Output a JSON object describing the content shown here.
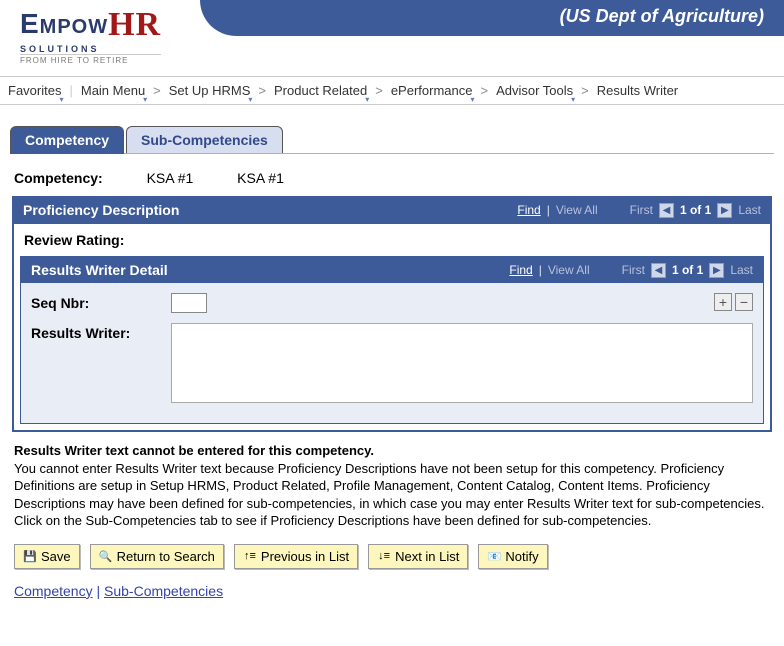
{
  "header": {
    "org": "(US Dept of Agriculture)",
    "logo": {
      "main1": "Empow",
      "main2": "HR",
      "sub": "SOLUTIONS",
      "tag": "FROM HIRE TO RETIRE"
    }
  },
  "breadcrumb": [
    "Favorites",
    "Main Menu",
    "Set Up HRMS",
    "Product Related",
    "ePerformance",
    "Advisor Tools",
    "Results Writer"
  ],
  "tabs": {
    "active": "Competency",
    "inactive": "Sub-Competencies"
  },
  "competency": {
    "label": "Competency:",
    "code": "KSA #1",
    "desc": "KSA #1"
  },
  "proficiency": {
    "title": "Proficiency Description",
    "nav": {
      "find": "Find",
      "viewall": "View All",
      "first": "First",
      "position": "1 of 1",
      "last": "Last"
    },
    "rating_label": "Review Rating:"
  },
  "detail": {
    "title": "Results Writer Detail",
    "nav": {
      "find": "Find",
      "viewall": "View All",
      "first": "First",
      "position": "1 of 1",
      "last": "Last"
    },
    "seq_label": "Seq Nbr:",
    "rw_label": "Results Writer:",
    "seq_value": ""
  },
  "warning": {
    "heading": "Results Writer text cannot be entered for this competency.",
    "body": "You cannot enter Results Writer text because Proficiency Descriptions have not been setup for this competency. Proficiency Definitions are setup in Setup HRMS, Product Related, Profile Management, Content Catalog, Content Items. Proficiency Descriptions may have been defined for sub-competencies, in which case you may enter Results Writer text for sub-competencies. Click on the Sub-Competencies tab to see if Proficiency Descriptions have been defined for sub-competencies."
  },
  "buttons": {
    "save": "Save",
    "return": "Return to Search",
    "prev": "Previous in List",
    "next": "Next in List",
    "notify": "Notify"
  },
  "footer": {
    "a": "Competency",
    "sep": " | ",
    "b": "Sub-Competencies"
  }
}
